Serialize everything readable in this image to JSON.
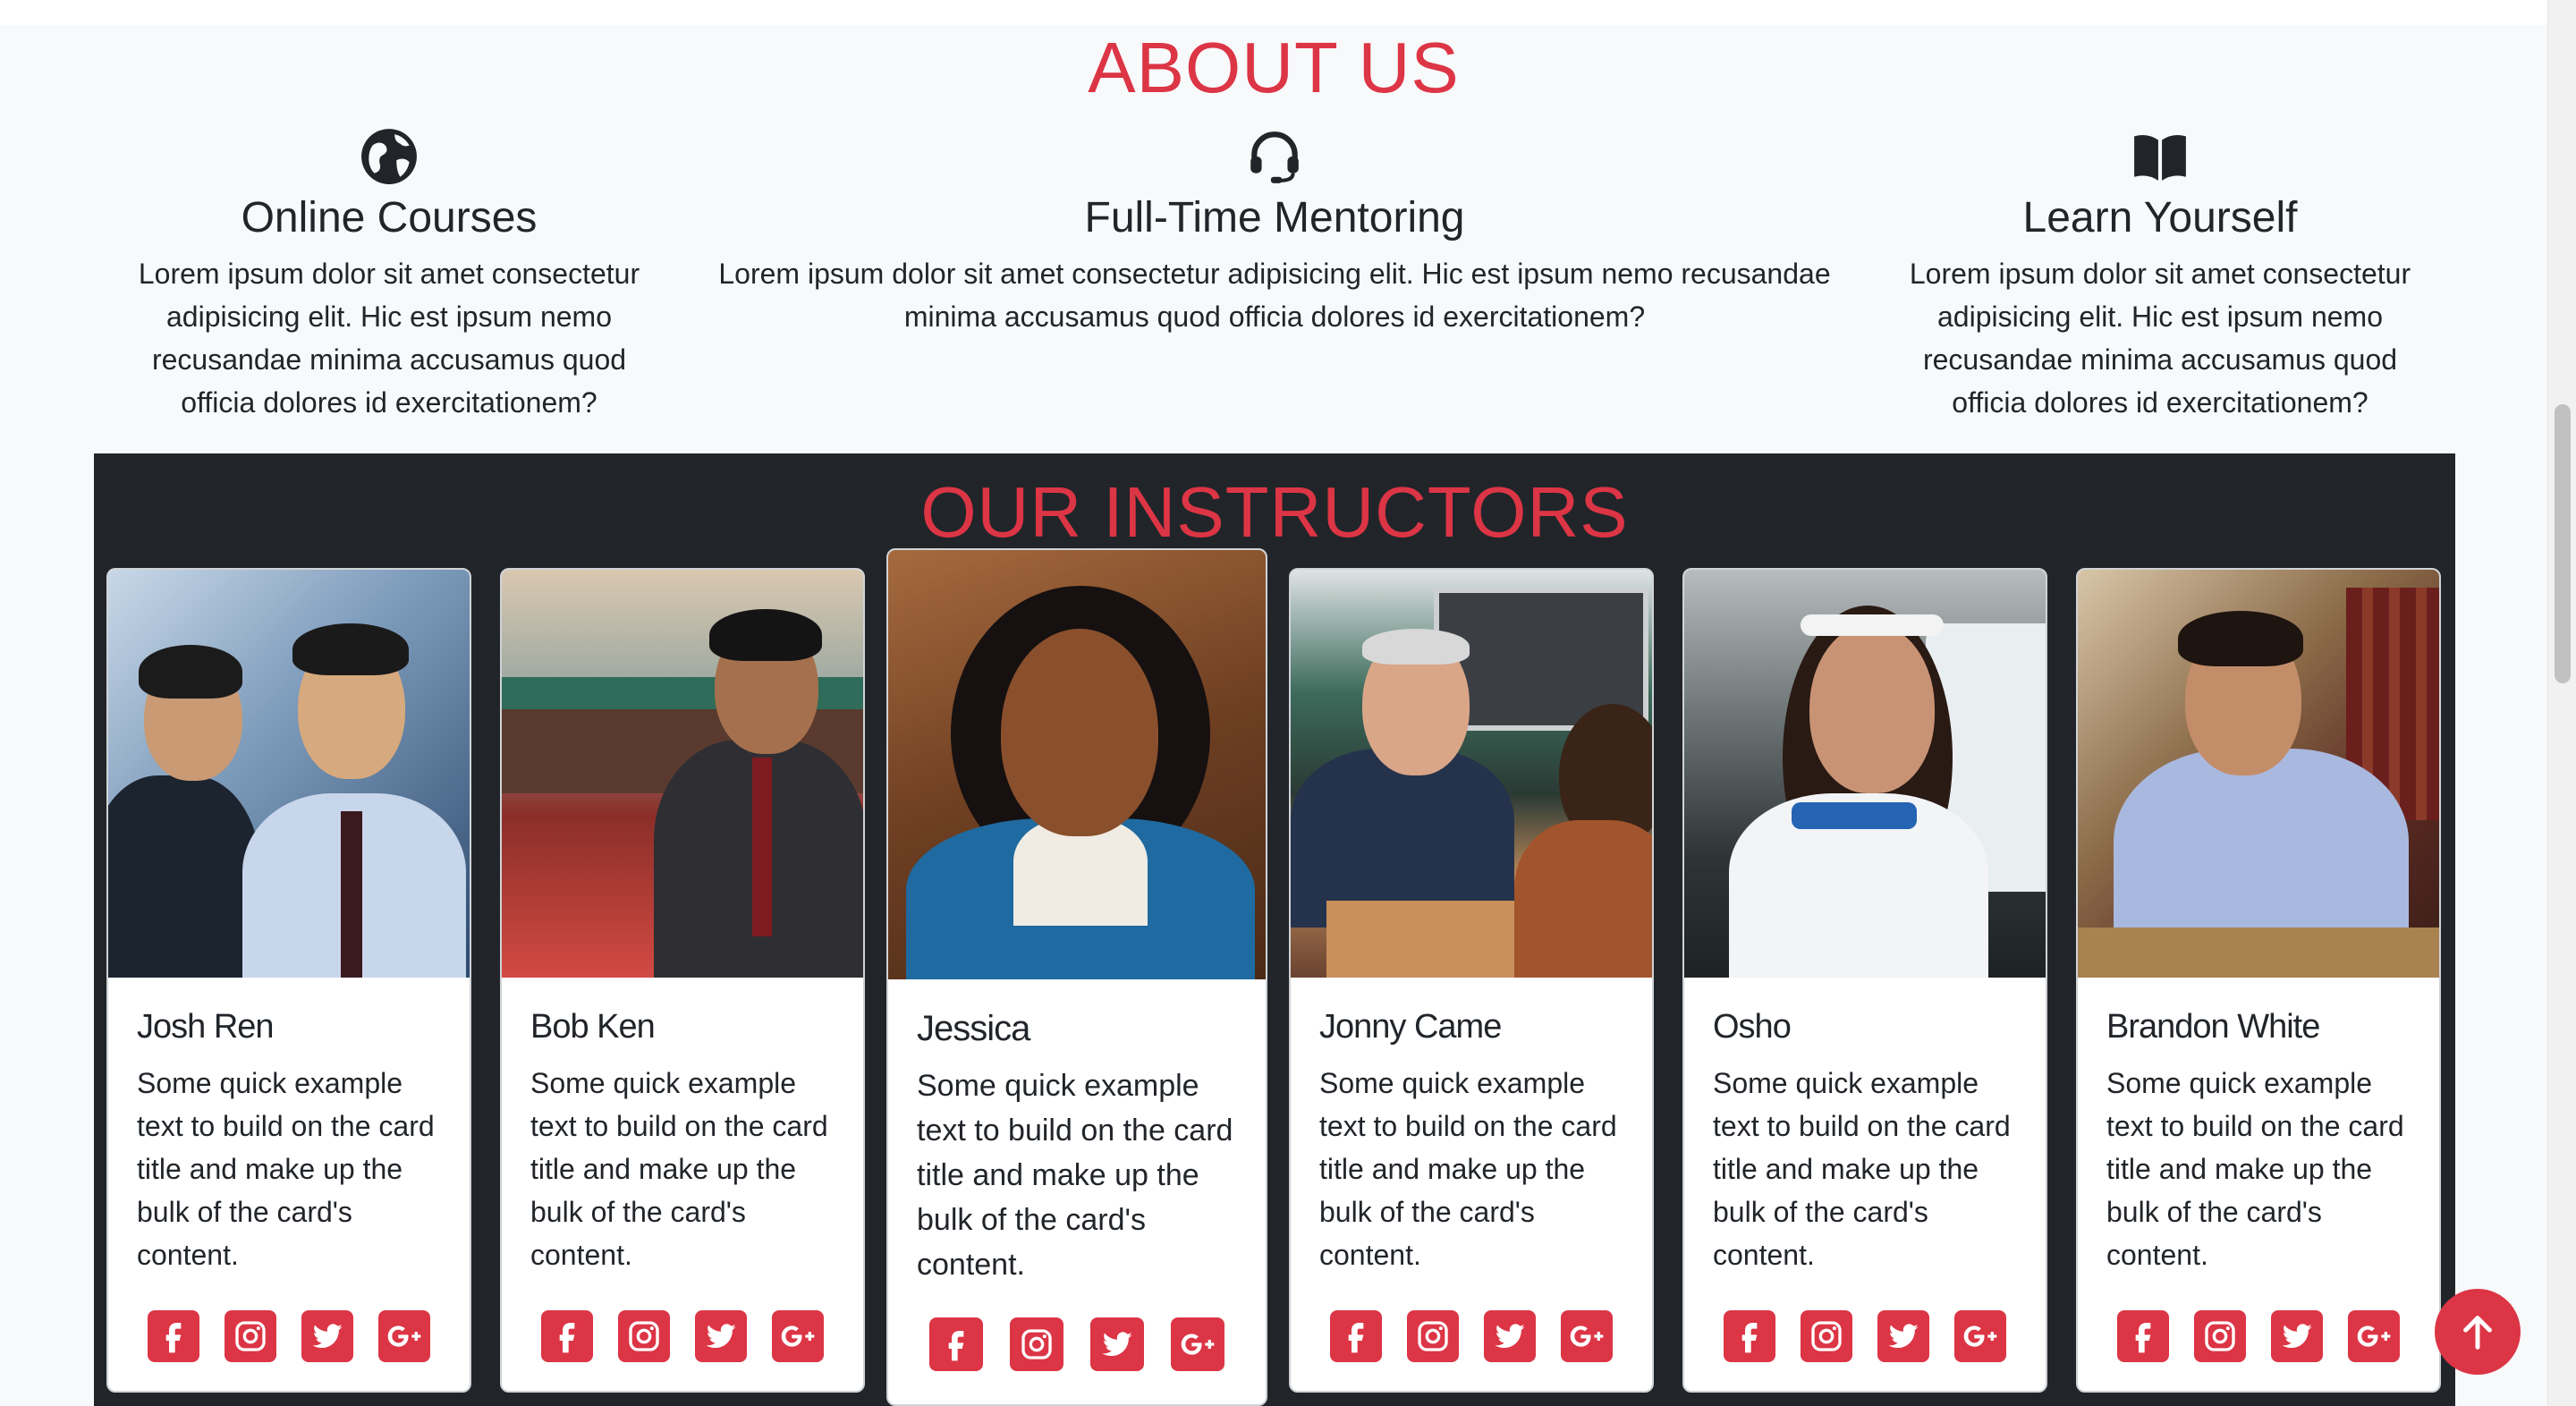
{
  "about": {
    "title": "ABOUT US",
    "features": [
      {
        "icon": "globe-icon",
        "title": "Online Courses",
        "text": "Lorem ipsum dolor sit amet consectetur adipisicing elit. Hic est ipsum nemo recusandae minima accusamus quod officia dolores id exercitationem?"
      },
      {
        "icon": "headset-icon",
        "title": "Full-Time Mentoring",
        "text": "Lorem ipsum dolor sit amet consectetur adipisicing elit. Hic est ipsum nemo recusandae minima accusamus quod officia dolores id exercitationem?"
      },
      {
        "icon": "book-open-icon",
        "title": "Learn Yourself",
        "text": "Lorem ipsum dolor sit amet consectetur adipisicing elit. Hic est ipsum nemo recusandae minima accusamus quod officia dolores id exercitationem?"
      }
    ]
  },
  "instructors": {
    "title": "OUR INSTRUCTORS",
    "cards": [
      {
        "name": "Josh Ren",
        "text": "Some quick example text to build on the card title and make up the bulk of the card's content."
      },
      {
        "name": "Bob Ken",
        "text": "Some quick example text to build on the card title and make up the bulk of the card's content."
      },
      {
        "name": "Jessica",
        "text": "Some quick example text to build on the card title and make up the bulk of the card's content."
      },
      {
        "name": "Jonny Came",
        "text": "Some quick example text to build on the card title and make up the bulk of the card's content."
      },
      {
        "name": "Osho",
        "text": "Some quick example text to build on the card title and make up the bulk of the card's content."
      },
      {
        "name": "Brandon White",
        "text": "Some quick example text to build on the card title and make up the bulk of the card's content."
      }
    ],
    "social_icons": [
      "facebook-icon",
      "instagram-icon",
      "twitter-icon",
      "google-plus-icon"
    ]
  },
  "colors": {
    "accent": "#dc3545",
    "dark_section": "#212529",
    "page_bg": "#f8f9fa"
  },
  "back_to_top_icon": "arrow-up-icon"
}
